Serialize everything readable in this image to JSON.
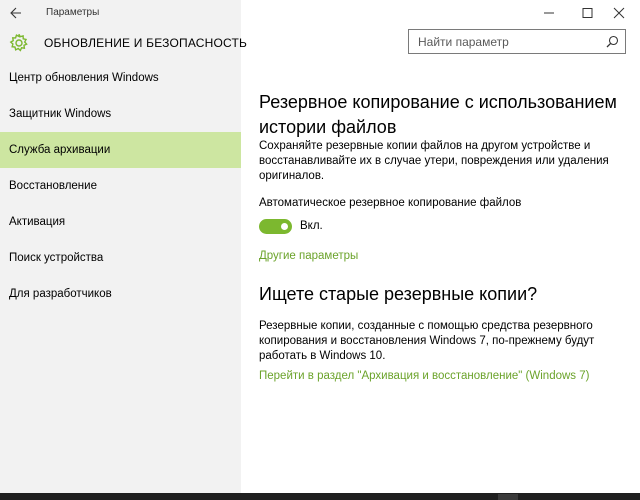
{
  "window": {
    "title": "Параметры"
  },
  "header": {
    "section_title": "ОБНОВЛЕНИЕ И БЕЗОПАСНОСТЬ",
    "search_placeholder": "Найти параметр"
  },
  "sidebar": {
    "items": [
      {
        "label": "Центр обновления Windows",
        "active": false
      },
      {
        "label": "Защитник Windows",
        "active": false
      },
      {
        "label": "Служба архивации",
        "active": true
      },
      {
        "label": "Восстановление",
        "active": false
      },
      {
        "label": "Активация",
        "active": false
      },
      {
        "label": "Поиск устройства",
        "active": false
      },
      {
        "label": "Для разработчиков",
        "active": false
      }
    ]
  },
  "main": {
    "heading": "Резервное копирование с использованием истории файлов",
    "description": "Сохраняйте резервные копии файлов на другом устройстве и восстанавливайте их в случае утери, повреждения или удаления оригиналов.",
    "auto_backup_label": "Автоматическое резервное копирование файлов",
    "toggle_state": "Вкл.",
    "toggle_on": true,
    "more_options_link": "Другие параметры",
    "old_backups_heading": "Ищете старые резервные копии?",
    "old_backups_description": "Резервные копии, созданные с помощью средства резервного копирования и восстановления Windows 7, по-прежнему будут работать в Windows 10.",
    "restore_link": "Перейти в раздел \"Архивация и восстановление\" (Windows 7)"
  },
  "colors": {
    "accent": "#7cb82f",
    "active_nav": "#cde6a1",
    "link": "#6ba32a",
    "sidebar_bg": "#f2f2f2"
  }
}
